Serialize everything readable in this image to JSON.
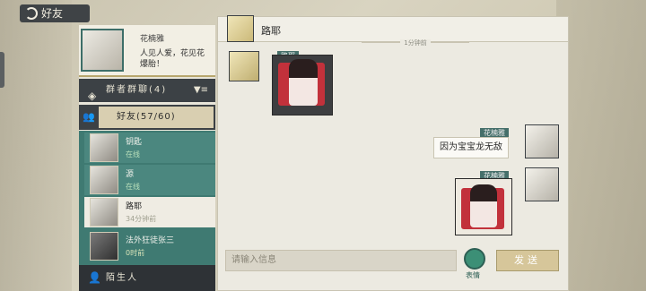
{
  "header": {
    "back_label": "好友"
  },
  "profile": {
    "name": "花楠雅",
    "signature": "人见人爱，花见花爆胎！"
  },
  "groups": {
    "group_chat_label": "群者群聊",
    "group_chat_count": "(4)",
    "friends_label": "好友",
    "friends_count": "(57/60)",
    "strangers_label": "陌生人"
  },
  "friends": [
    {
      "name": "钥匙",
      "status": "在线"
    },
    {
      "name": "源",
      "status": "在线"
    },
    {
      "name": "路耶",
      "status": "34分钟前"
    },
    {
      "name": "法外狂徒张三",
      "status": "0时前"
    }
  ],
  "chat": {
    "title": "路耶",
    "time_label": "1分钟前",
    "peer_tag": "路耶",
    "self_tag_1": "花楠雅",
    "self_msg_1": "因为宝宝龙无敌",
    "self_tag_2": "花楠雅",
    "input_placeholder": "请输入信息",
    "emoji_label": "表情",
    "send_label": "发送"
  }
}
